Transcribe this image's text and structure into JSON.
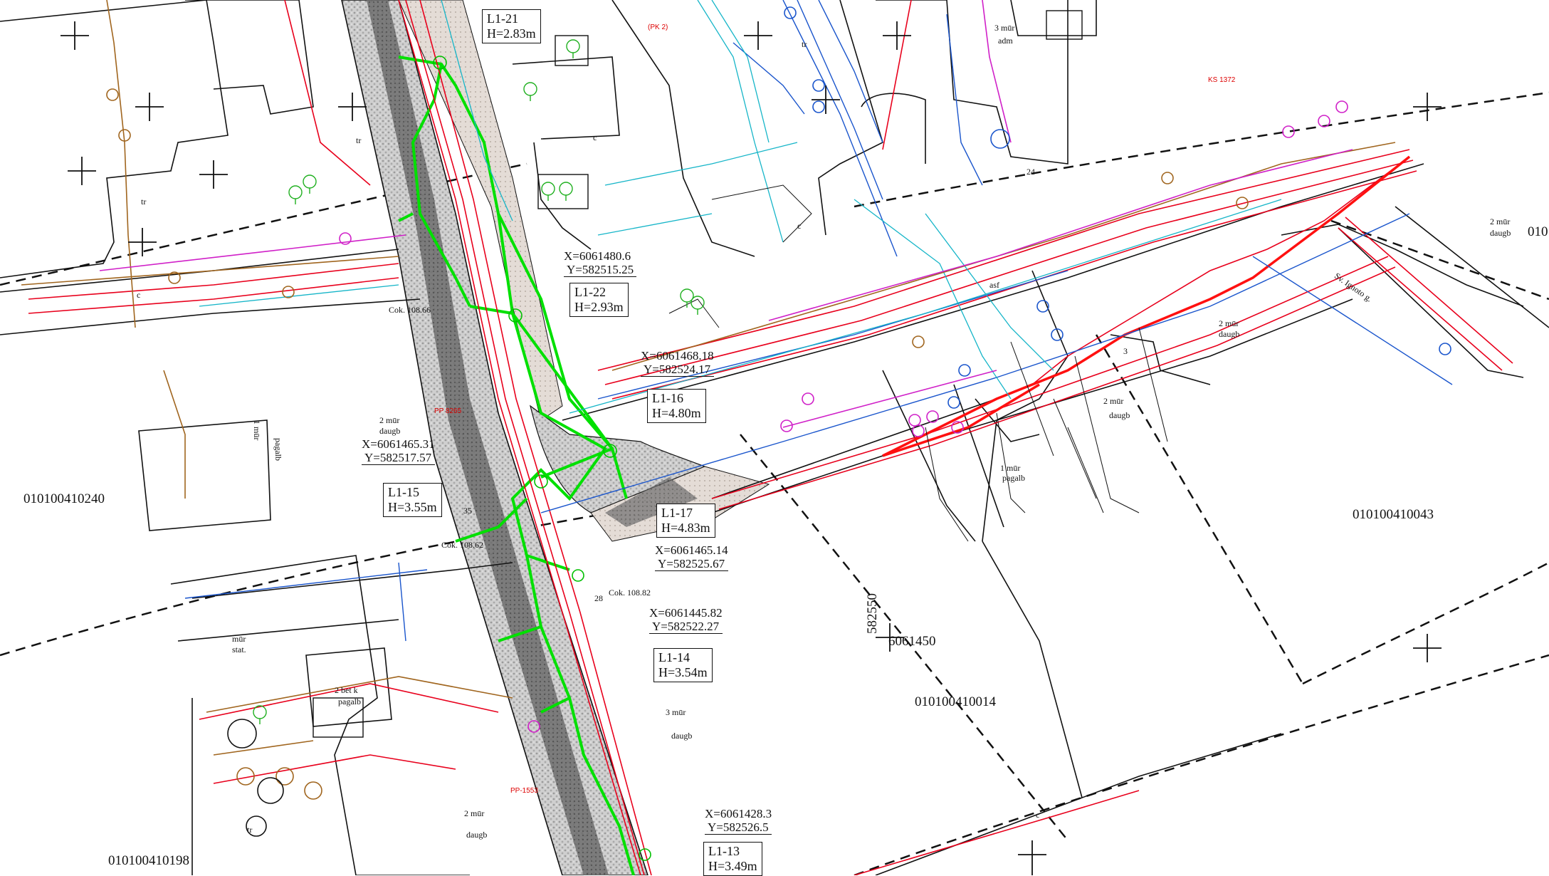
{
  "parcels": [
    {
      "id": "parcel-240",
      "label": "010100410240"
    },
    {
      "id": "parcel-198",
      "label": "010100410198"
    },
    {
      "id": "parcel-014",
      "label": "010100410014"
    },
    {
      "id": "parcel-043",
      "label": "010100410043"
    },
    {
      "id": "parcel-010",
      "label": "010"
    }
  ],
  "grid": {
    "easting": "582550",
    "northing": "6061450"
  },
  "manholes": [
    {
      "name": "L1-21",
      "depth": "H=2.83m"
    },
    {
      "name": "L1-22",
      "depth": "H=2.93m"
    },
    {
      "name": "L1-16",
      "depth": "H=4.80m"
    },
    {
      "name": "L1-15",
      "depth": "H=3.55m"
    },
    {
      "name": "L1-17",
      "depth": "H=4.83m"
    },
    {
      "name": "L1-14",
      "depth": "H=3.54m"
    },
    {
      "name": "L1-13",
      "depth": "H=3.49m"
    }
  ],
  "coordinates": [
    {
      "x": "X=6061480.6",
      "y": "Y=582515.25"
    },
    {
      "x": "X=6061468.18",
      "y": "Y=582524.17"
    },
    {
      "x": "X=6061465.31",
      "y": "Y=582517.57"
    },
    {
      "x": "X=6061465.14",
      "y": "Y=582525.67"
    },
    {
      "x": "X=6061445.82",
      "y": "Y=582522.27"
    },
    {
      "x": "X=6061428.3",
      "y": "Y=582526.5"
    }
  ],
  "annotations": {
    "cok1": "Cok. 108.66",
    "cok2": "Cok. 108.62",
    "cok3": "Cok. 108.82",
    "b2mur1": "2 mūr",
    "daugb1": "daugb",
    "b2mur2": "2 mūr",
    "daugb2": "daugb",
    "b2mur3": "2 mūr",
    "daugb3": "daugb",
    "b2mur4": "2 mūr",
    "daugb4": "daugb",
    "b3mur": "3 mūr",
    "daugb5": "daugb",
    "b2mur5": "2 mūr",
    "daugb6": "daugb",
    "b1mur": "1 mūr",
    "pagalb1": "pagalb",
    "mur": "mūr",
    "stat": "stat.",
    "b2bet": "2 bet k",
    "pagalb2": "pagalb",
    "b3mur_adm": "3 mūr",
    "adm": "adm",
    "b1mur2": "1 mūr",
    "pagalb3": "pagalb",
    "street": "Sv. Ignoto g.",
    "n35": "35",
    "n28": "28",
    "n24": "24",
    "n3": "3",
    "pp8265": "PP 8265",
    "pp1553": "PP-1553",
    "ks1372": "KS 1372",
    "pk2": "(PK 2)",
    "tr1": "tr",
    "tr2": "tr",
    "tr3": "tr",
    "tr4": "tr",
    "asf": "asf",
    "c1": "c",
    "c2": "c",
    "c3": "c",
    "c4": "c"
  },
  "colors": {
    "road_edge": "#111111",
    "sewer_green": "#00e000",
    "electric_red": "#e8001c",
    "water_blue": "#1a55cc",
    "telecom_cyan": "#15b5c8",
    "gas_brown": "#a0651e",
    "heat_magenta": "#d020c8",
    "elevation_green": "#20b020"
  }
}
